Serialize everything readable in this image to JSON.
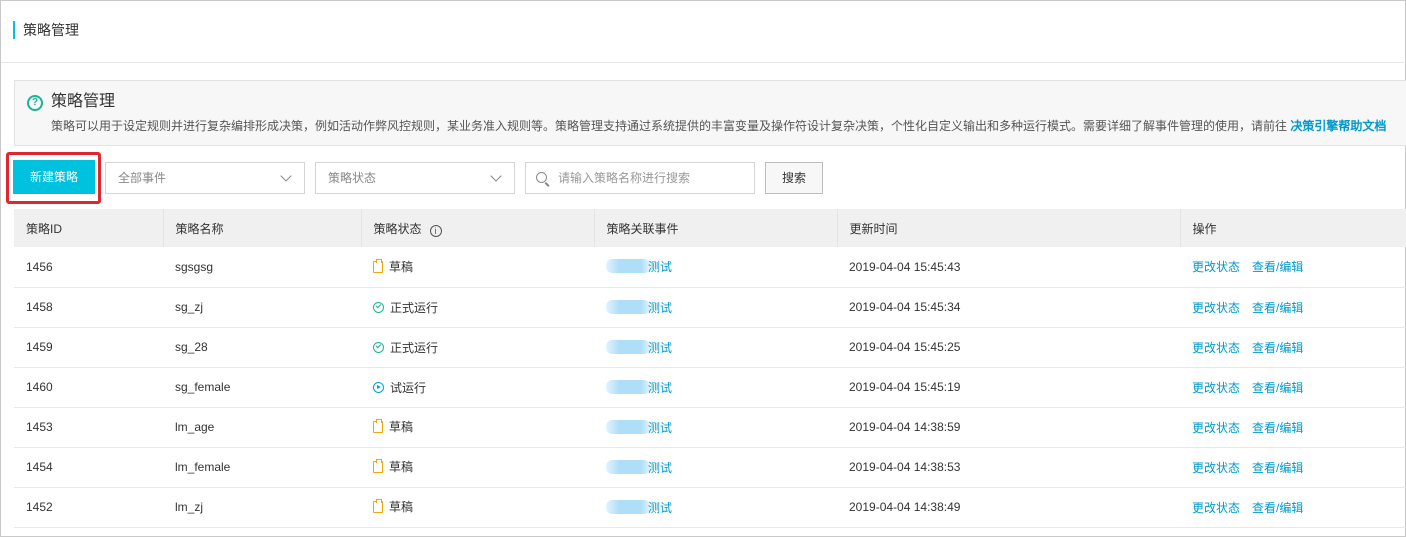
{
  "header": {
    "title": "策略管理"
  },
  "info": {
    "title": "策略管理",
    "description": "策略可以用于设定规则并进行复杂编排形成决策，例如活动作弊风控规则，某业务准入规则等。策略管理支持通过系统提供的丰富变量及操作符设计复杂决策，个性化自定义输出和多种运行模式。需要详细了解事件管理的使用，请前往 ",
    "link_label": "决策引擎帮助文档"
  },
  "toolbar": {
    "new_button": "新建策略",
    "event_select": "全部事件",
    "status_select": "策略状态",
    "search_placeholder": "请输入策略名称进行搜索",
    "search_button": "搜索"
  },
  "table": {
    "columns": [
      "策略ID",
      "策略名称",
      "策略状态",
      "策略关联事件",
      "更新时间",
      "操作"
    ],
    "info_icon": "i",
    "rows": [
      {
        "id": "1456",
        "name": "sgsgsg",
        "status": "草稿",
        "status_icon": "draft-icon",
        "event": "测试",
        "updated": "2019-04-04 15:45:43"
      },
      {
        "id": "1458",
        "name": "sg_zj",
        "status": "正式运行",
        "status_icon": "check-circle-icon",
        "event": "测试",
        "updated": "2019-04-04 15:45:34"
      },
      {
        "id": "1459",
        "name": "sg_28",
        "status": "正式运行",
        "status_icon": "check-circle-icon",
        "event": "测试",
        "updated": "2019-04-04 15:45:25"
      },
      {
        "id": "1460",
        "name": "sg_female",
        "status": "试运行",
        "status_icon": "play-circle-icon",
        "event": "测试",
        "updated": "2019-04-04 15:45:19"
      },
      {
        "id": "1453",
        "name": "lm_age",
        "status": "草稿",
        "status_icon": "draft-icon",
        "event": "测试",
        "updated": "2019-04-04 14:38:59"
      },
      {
        "id": "1454",
        "name": "lm_female",
        "status": "草稿",
        "status_icon": "draft-icon",
        "event": "测试",
        "updated": "2019-04-04 14:38:53"
      },
      {
        "id": "1452",
        "name": "lm_zj",
        "status": "草稿",
        "status_icon": "draft-icon",
        "event": "测试",
        "updated": "2019-04-04 14:38:49"
      }
    ],
    "actions": {
      "change_status": "更改状态",
      "view_edit": "查看/编辑"
    }
  },
  "colors": {
    "accent": "#00c1de",
    "link": "#0099cc",
    "highlight_border": "#e0262e",
    "draft": "#f0a800",
    "running": "#1ab394"
  }
}
